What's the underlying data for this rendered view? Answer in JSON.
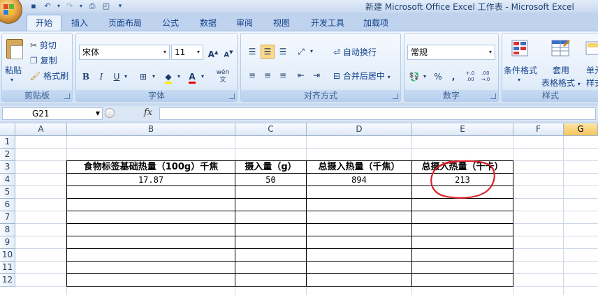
{
  "window": {
    "title": "新建 Microsoft Office Excel 工作表 - Microsoft Excel"
  },
  "tabs": [
    {
      "label": "开始",
      "active": true
    },
    {
      "label": "插入"
    },
    {
      "label": "页面布局"
    },
    {
      "label": "公式"
    },
    {
      "label": "数据"
    },
    {
      "label": "审阅"
    },
    {
      "label": "视图"
    },
    {
      "label": "开发工具"
    },
    {
      "label": "加载项"
    }
  ],
  "ribbon": {
    "clipboard": {
      "label": "剪贴板",
      "paste": "粘贴",
      "cut": "剪切",
      "copy": "复制",
      "format_painter": "格式刷"
    },
    "font": {
      "label": "字体",
      "font_name": "宋体",
      "font_size": "11",
      "bold": "B",
      "italic": "I",
      "underline": "U",
      "grow": "A",
      "shrink": "A",
      "font_color": "A",
      "phonetic": "wén 文"
    },
    "alignment": {
      "label": "对齐方式",
      "wrap_text": "自动换行",
      "merge_center": "合并后居中"
    },
    "number": {
      "label": "数字",
      "format": "常规",
      "percent": "%",
      "comma": ",",
      "inc_decimal": "+.0 .00",
      "dec_decimal": ".00 →.0"
    },
    "styles": {
      "label": "样式",
      "conditional": "条件格式",
      "table_format_1": "套用",
      "table_format_2": "表格格式",
      "cell_styles_1": "单元",
      "cell_styles_2": "样式"
    }
  },
  "formula_bar": {
    "name_box": "G21",
    "fx": "fx",
    "value": ""
  },
  "columns": [
    "A",
    "B",
    "C",
    "D",
    "E",
    "F",
    "G"
  ],
  "rows": [
    "1",
    "2",
    "3",
    "4",
    "5",
    "6",
    "7",
    "8",
    "9",
    "10",
    "11",
    "12"
  ],
  "table": {
    "headers": [
      "食物标签基础热量（100g）千焦",
      "摄入量（g）",
      "总摄入热量（千焦）",
      "总摄入热量（千卡）"
    ],
    "row4": [
      "17.87",
      "50",
      "894",
      "213"
    ]
  },
  "colors": {
    "annotation": "#d8232a"
  }
}
